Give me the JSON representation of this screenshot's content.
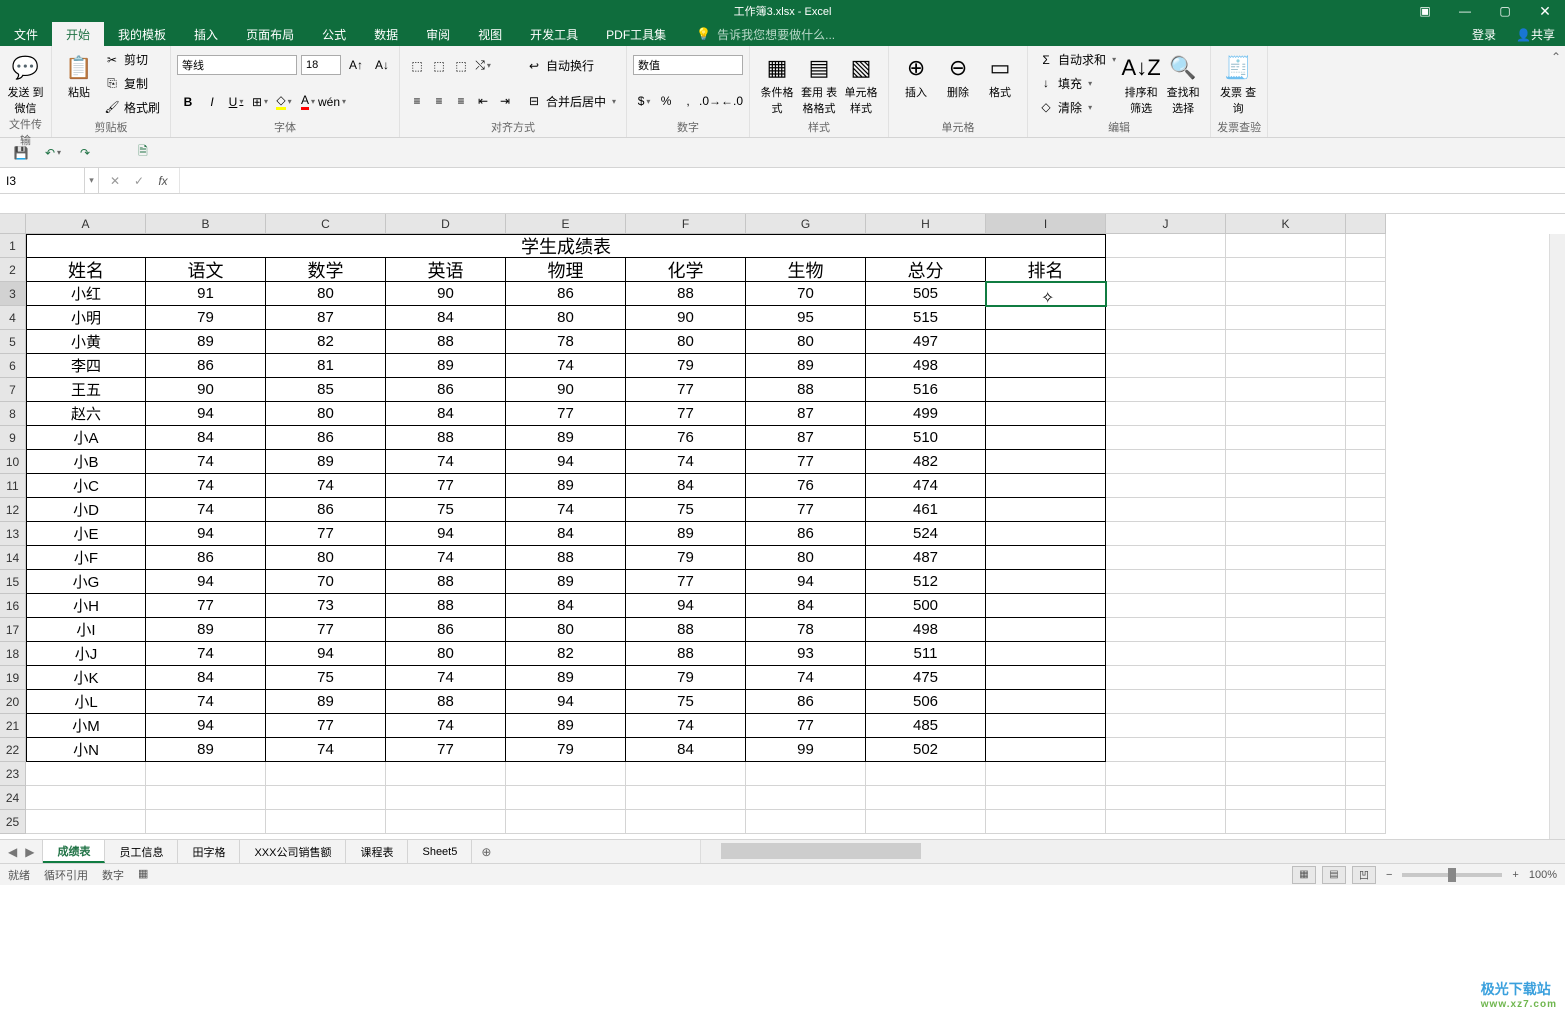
{
  "title": "工作簿3.xlsx - Excel",
  "menus": [
    "文件",
    "开始",
    "我的模板",
    "插入",
    "页面布局",
    "公式",
    "数据",
    "审阅",
    "视图",
    "开发工具",
    "PDF工具集"
  ],
  "tellme": "告诉我您想要做什么...",
  "login": "登录",
  "share": "共享",
  "ribbon": {
    "group1_label": "文件传输",
    "send_wechat": "发送\n到微信",
    "group2_label": "剪贴板",
    "paste": "粘贴",
    "cut": "剪切",
    "copy": "复制",
    "fmtpaint": "格式刷",
    "group3_label": "字体",
    "fontname": "等线",
    "fontsize": "18",
    "bold": "B",
    "italic": "I",
    "underline": "U",
    "group4_label": "对齐方式",
    "wrap": "自动换行",
    "merge": "合并后居中",
    "group5_label": "数字",
    "numfmt": "数值",
    "group6_label": "样式",
    "cond": "条件格式",
    "tbl": "套用\n表格格式",
    "cellstyle": "单元格样式",
    "group7_label": "单元格",
    "insert": "插入",
    "delete": "删除",
    "format": "格式",
    "group8_label": "编辑",
    "autosum": "自动求和",
    "fill": "填充",
    "clear": "清除",
    "sort": "排序和筛选",
    "find": "查找和选择",
    "group9_label": "发票查验",
    "invoice": "发票\n查询"
  },
  "fbar": {
    "namebox": "I3",
    "fx": "fx"
  },
  "columns": [
    "A",
    "B",
    "C",
    "D",
    "E",
    "F",
    "G",
    "H",
    "I",
    "J",
    "K"
  ],
  "tableTitle": "学生成绩表",
  "headers": [
    "姓名",
    "语文",
    "数学",
    "英语",
    "物理",
    "化学",
    "生物",
    "总分",
    "排名"
  ],
  "rows": [
    [
      "小红",
      "91",
      "80",
      "90",
      "86",
      "88",
      "70",
      "505",
      ""
    ],
    [
      "小明",
      "79",
      "87",
      "84",
      "80",
      "90",
      "95",
      "515",
      ""
    ],
    [
      "小黄",
      "89",
      "82",
      "88",
      "78",
      "80",
      "80",
      "497",
      ""
    ],
    [
      "李四",
      "86",
      "81",
      "89",
      "74",
      "79",
      "89",
      "498",
      ""
    ],
    [
      "王五",
      "90",
      "85",
      "86",
      "90",
      "77",
      "88",
      "516",
      ""
    ],
    [
      "赵六",
      "94",
      "80",
      "84",
      "77",
      "77",
      "87",
      "499",
      ""
    ],
    [
      "小A",
      "84",
      "86",
      "88",
      "89",
      "76",
      "87",
      "510",
      ""
    ],
    [
      "小B",
      "74",
      "89",
      "74",
      "94",
      "74",
      "77",
      "482",
      ""
    ],
    [
      "小C",
      "74",
      "74",
      "77",
      "89",
      "84",
      "76",
      "474",
      ""
    ],
    [
      "小D",
      "74",
      "86",
      "75",
      "74",
      "75",
      "77",
      "461",
      ""
    ],
    [
      "小E",
      "94",
      "77",
      "94",
      "84",
      "89",
      "86",
      "524",
      ""
    ],
    [
      "小F",
      "86",
      "80",
      "74",
      "88",
      "79",
      "80",
      "487",
      ""
    ],
    [
      "小G",
      "94",
      "70",
      "88",
      "89",
      "77",
      "94",
      "512",
      ""
    ],
    [
      "小H",
      "77",
      "73",
      "88",
      "84",
      "94",
      "84",
      "500",
      ""
    ],
    [
      "小I",
      "89",
      "77",
      "86",
      "80",
      "88",
      "78",
      "498",
      ""
    ],
    [
      "小J",
      "74",
      "94",
      "80",
      "82",
      "88",
      "93",
      "511",
      ""
    ],
    [
      "小K",
      "84",
      "75",
      "74",
      "89",
      "79",
      "74",
      "475",
      ""
    ],
    [
      "小L",
      "74",
      "89",
      "88",
      "94",
      "75",
      "86",
      "506",
      ""
    ],
    [
      "小M",
      "94",
      "77",
      "74",
      "89",
      "74",
      "77",
      "485",
      ""
    ],
    [
      "小N",
      "89",
      "74",
      "77",
      "79",
      "84",
      "99",
      "502",
      ""
    ]
  ],
  "sheets": [
    "成绩表",
    "员工信息",
    "田字格",
    "XXX公司销售额",
    "课程表",
    "Sheet5"
  ],
  "status": {
    "ready": "就绪",
    "circ": "循环引用",
    "num": "数字",
    "zoom": "100%"
  },
  "watermark": {
    "t1": "极光下载站",
    "t2": "www.xz7.com"
  }
}
